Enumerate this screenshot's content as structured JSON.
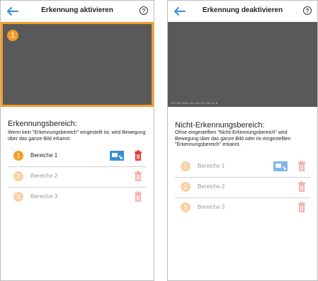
{
  "left": {
    "title": "Erkennung aktivieren",
    "help": "?",
    "video_badge": "1",
    "section_title": "Erkennungsbereich:",
    "section_desc": "Wenn kein \"Erkennungsbereich\" eingestellt ist, wird Bewegung über das ganze Bild erkannt.",
    "areas": [
      {
        "num": "1",
        "label": "Bereiche 1"
      },
      {
        "num": "2",
        "label": "Bereiche 2"
      },
      {
        "num": "3",
        "label": "Bereiche 3"
      }
    ]
  },
  "right": {
    "title": "Erkennung deaktivieren",
    "help": "?",
    "video_timestamp": "VFCW  2021-01-18  21:15:14  8",
    "section_title": "Nicht-Erkennungsbereich:",
    "section_desc": "Ohne eingestellten \"Nicht-Erkennungsbereich\" wird Bewegung über das ganze Bild oder im eingestellten \"Erkennungsbereich\" erkannt.",
    "areas": [
      {
        "num": "1",
        "label": "Bereiche 1"
      },
      {
        "num": "2",
        "label": "Bereiche 2"
      },
      {
        "num": "3",
        "label": "Bereiche 3"
      }
    ]
  },
  "colors": {
    "accent_orange": "#f39c2a",
    "accent_blue": "#3a8fd6",
    "trash_red": "#e53935"
  },
  "icons": {
    "back": "back-arrow-icon",
    "help": "help-icon",
    "edit": "area-edit-icon",
    "delete": "trash-icon"
  }
}
